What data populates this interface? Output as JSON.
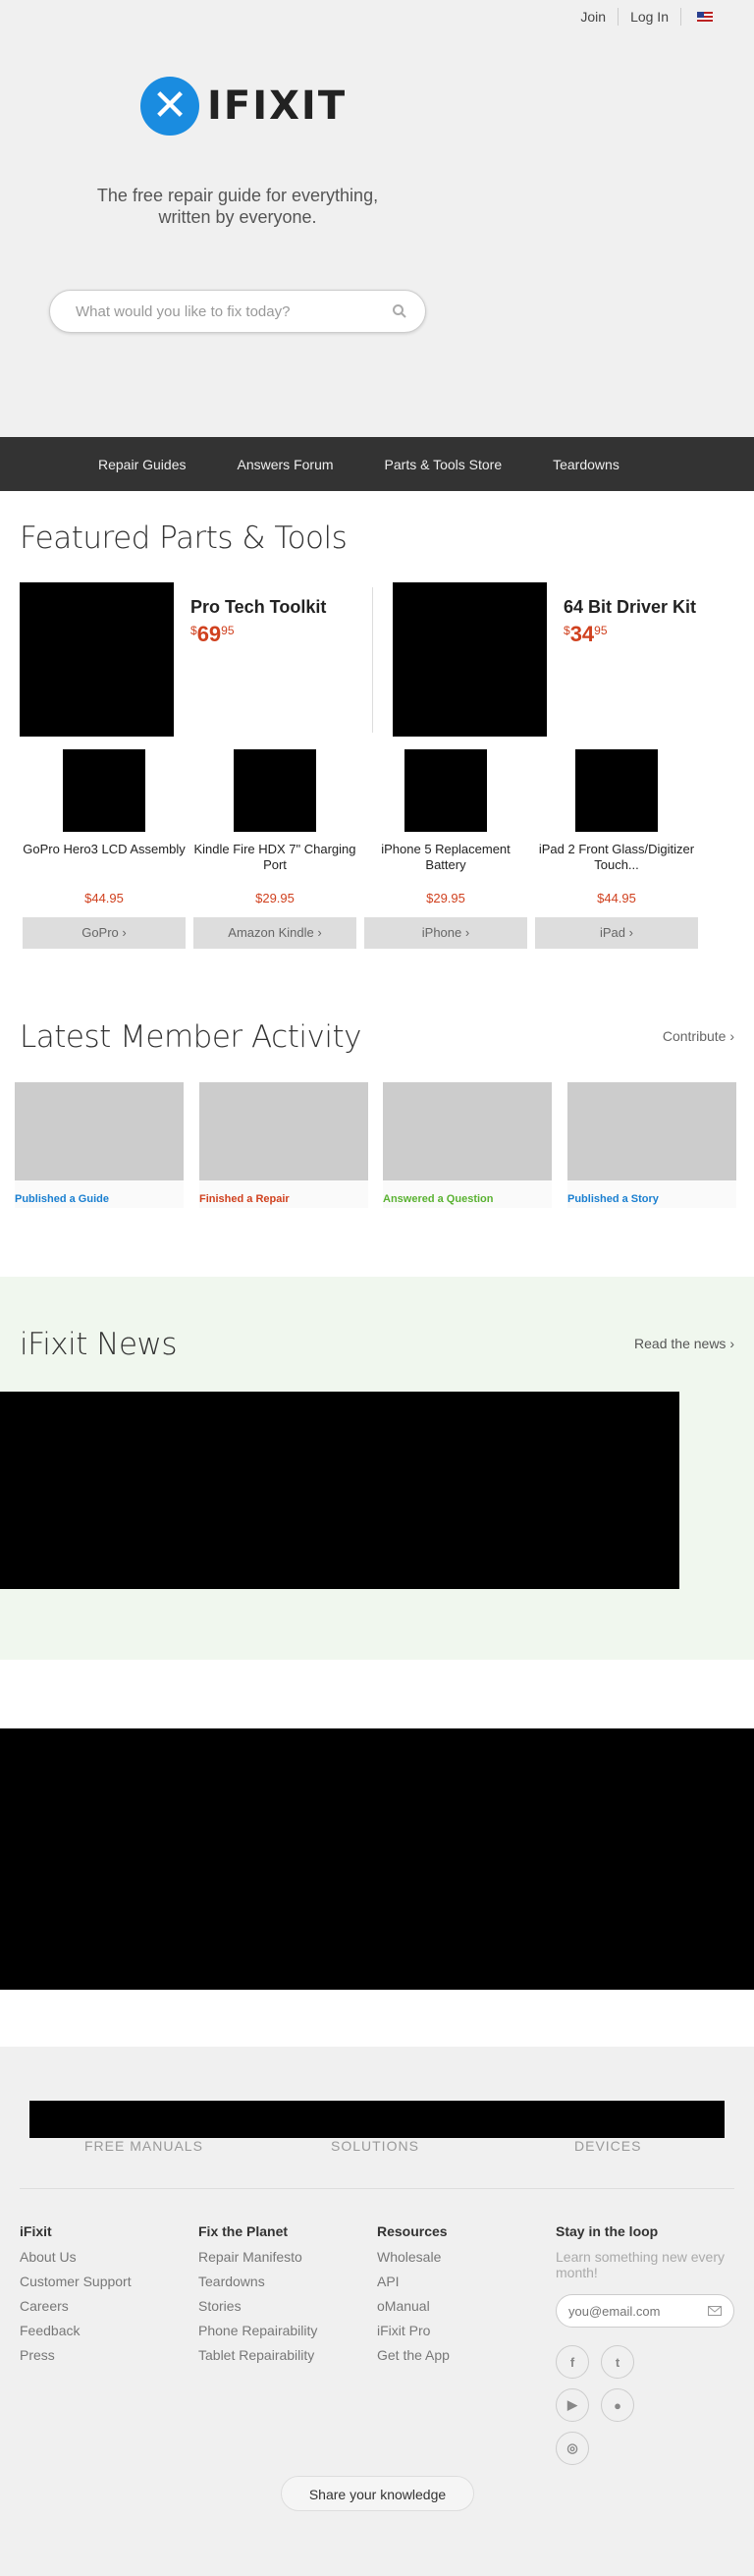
{
  "topnav": {
    "join": "Join",
    "login": "Log In"
  },
  "logo": {
    "text": "IFIXIT"
  },
  "hero": {
    "tagline": "The free repair guide for everything, written by everyone.",
    "search_placeholder": "What would you like to fix today?"
  },
  "mainnav": [
    {
      "label": "Repair Guides"
    },
    {
      "label": "Answers Forum"
    },
    {
      "label": "Parts & Tools Store"
    },
    {
      "label": "Teardowns"
    }
  ],
  "featured": {
    "title": "Featured Parts & Tools",
    "big": [
      {
        "name": "Pro Tech Toolkit",
        "price_whole": "69",
        "price_cents": "95"
      },
      {
        "name": "64 Bit Driver Kit",
        "price_whole": "34",
        "price_cents": "95"
      }
    ],
    "small": [
      {
        "name": "GoPro Hero3 LCD Assembly",
        "price": "$44.95",
        "category": "GoPro"
      },
      {
        "name": "Kindle Fire HDX 7\" Charging Port",
        "price": "$29.95",
        "category": "Amazon Kindle"
      },
      {
        "name": "iPhone 5 Replacement Battery",
        "price": "$29.95",
        "category": "iPhone"
      },
      {
        "name": "iPad 2 Front Glass/Digitizer Touch...",
        "price": "$44.95",
        "category": "iPad"
      }
    ]
  },
  "activity": {
    "title": "Latest Member Activity",
    "contribute": "Contribute",
    "items": [
      {
        "label": "Published a Guide",
        "color": "#1a7fd0"
      },
      {
        "label": "Finished a Repair",
        "color": "#d0411f"
      },
      {
        "label": "Answered a Question",
        "color": "#5ab232"
      },
      {
        "label": "Published a Story",
        "color": "#1a7fd0"
      }
    ]
  },
  "news": {
    "title": "iFixit News",
    "read": "Read the news"
  },
  "footer": {
    "cats": [
      "FREE MANUALS",
      "SOLUTIONS",
      "DEVICES"
    ],
    "columns": [
      {
        "heading": "iFixit",
        "items": [
          "About Us",
          "Customer Support",
          "Careers",
          "Feedback",
          "Press"
        ]
      },
      {
        "heading": "Fix the Planet",
        "items": [
          "Repair Manifesto",
          "Teardowns",
          "Stories",
          "Phone Repairability",
          "Tablet Repairability"
        ]
      },
      {
        "heading": "Resources",
        "items": [
          "Wholesale",
          "API",
          "oManual",
          "iFixit Pro",
          "Get the App"
        ]
      }
    ],
    "stay": {
      "heading": "Stay in the loop",
      "desc": "Learn something new every month!",
      "email_placeholder": "you@email.com"
    },
    "share": "Share your knowledge"
  },
  "icons": {
    "search": "search-icon",
    "chevron": "chevron-right-icon",
    "email": "envelope-icon",
    "facebook": "facebook-icon",
    "twitter": "twitter-icon",
    "youtube": "youtube-icon",
    "github": "github-icon",
    "instagram": "instagram-icon",
    "flag": "us-flag-icon"
  }
}
